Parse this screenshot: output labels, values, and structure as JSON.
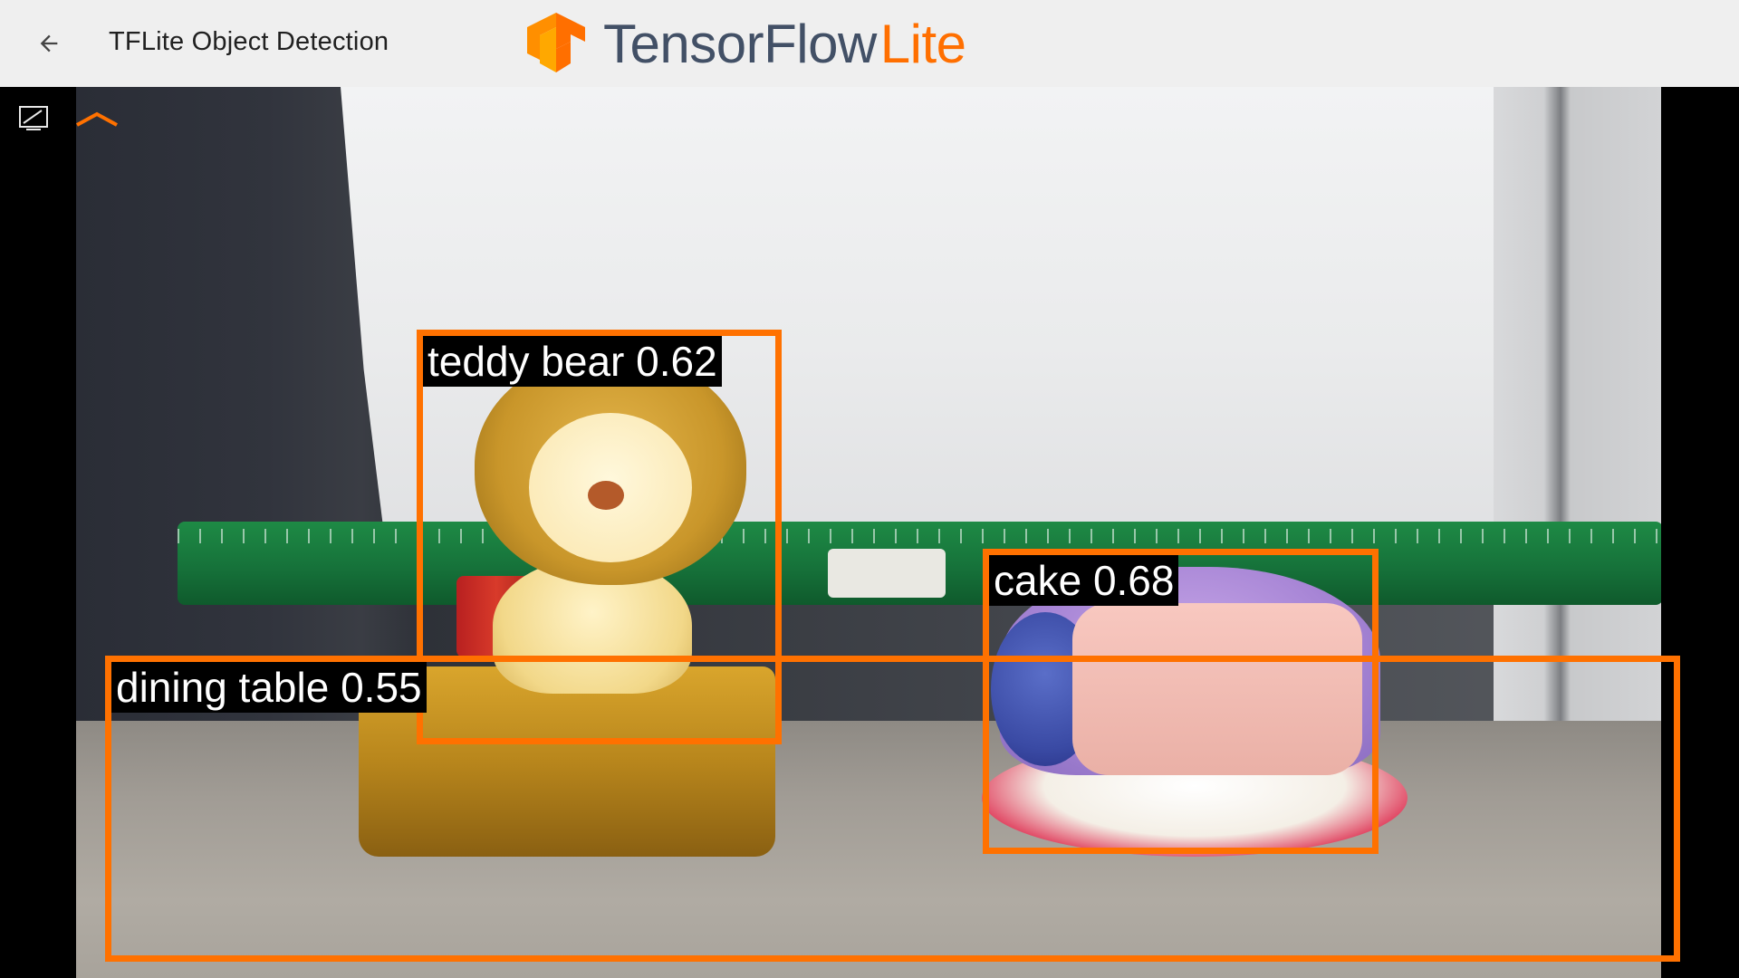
{
  "app_bar": {
    "title": "TFLite Object Detection",
    "logo": {
      "word_1": "TensorFlow",
      "word_2": "Lite"
    },
    "icons": {
      "back": "arrow-back-icon",
      "logo": "tensorflow-icon"
    }
  },
  "camera": {
    "controls": {
      "cast": "cast-icon",
      "expand": "chevron-up-icon"
    }
  },
  "detections": [
    {
      "label": "teddy bear 0.62"
    },
    {
      "label": "cake 0.68"
    },
    {
      "label": "dining table 0.55"
    }
  ],
  "colors": {
    "box": "#ff7100",
    "logo_orange": "#ff6f00",
    "logo_gray": "#425066",
    "app_bar": "#efefef"
  }
}
